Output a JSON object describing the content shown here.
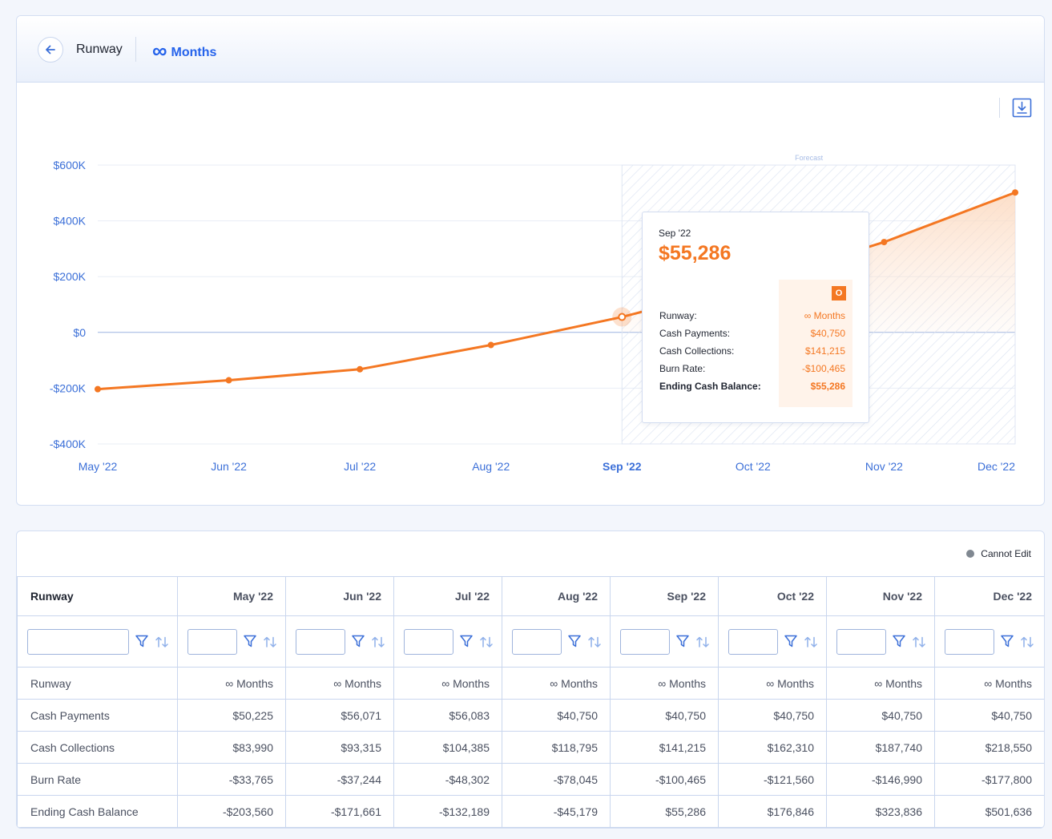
{
  "header": {
    "title": "Runway",
    "runway_symbol": "∞",
    "runway_label": "Months"
  },
  "chart": {
    "region_label": "Forecast",
    "colors": {
      "line": "#f47722",
      "axis_text": "#3b6fd8",
      "forecast_hatch": "#dbe3f2",
      "zero_line": "#9bb3e0"
    }
  },
  "chart_data": {
    "type": "line",
    "categories": [
      "May '22",
      "Jun '22",
      "Jul '22",
      "Aug '22",
      "Sep '22",
      "Oct '22",
      "Nov '22",
      "Dec '22"
    ],
    "series": [
      {
        "name": "Ending Cash Balance",
        "values": [
          -203560,
          -171661,
          -132189,
          -45179,
          55286,
          176846,
          323836,
          501636
        ]
      }
    ],
    "yticks": [
      "$600K",
      "$400K",
      "$200K",
      "$0",
      "-$200K",
      "-$400K"
    ],
    "ytick_values": [
      600000,
      400000,
      200000,
      0,
      -200000,
      -400000
    ],
    "ylim": [
      -400000,
      600000
    ],
    "highlighted": "Sep '22",
    "forecast_from": "Sep '22",
    "grid": true
  },
  "tooltip": {
    "date": "Sep '22",
    "value": "$55,286",
    "badge": "O",
    "rows": [
      {
        "label": "Runway:",
        "value": "∞ Months"
      },
      {
        "label": "Cash Payments:",
        "value": "$40,750"
      },
      {
        "label": "Cash Collections:",
        "value": "$141,215"
      },
      {
        "label": "Burn Rate:",
        "value": "-$100,465"
      },
      {
        "label": "Ending Cash Balance:",
        "value": "$55,286"
      }
    ]
  },
  "legend": {
    "label": "Cannot Edit"
  },
  "table": {
    "corner": "Runway",
    "columns": [
      "May '22",
      "Jun '22",
      "Jul '22",
      "Aug '22",
      "Sep '22",
      "Oct '22",
      "Nov '22",
      "Dec '22"
    ],
    "rows": [
      {
        "label": "Runway",
        "values": [
          "∞ Months",
          "∞ Months",
          "∞ Months",
          "∞ Months",
          "∞ Months",
          "∞ Months",
          "∞ Months",
          "∞ Months"
        ]
      },
      {
        "label": "Cash Payments",
        "values": [
          "$50,225",
          "$56,071",
          "$56,083",
          "$40,750",
          "$40,750",
          "$40,750",
          "$40,750",
          "$40,750"
        ]
      },
      {
        "label": "Cash Collections",
        "values": [
          "$83,990",
          "$93,315",
          "$104,385",
          "$118,795",
          "$141,215",
          "$162,310",
          "$187,740",
          "$218,550"
        ]
      },
      {
        "label": "Burn Rate",
        "values": [
          "-$33,765",
          "-$37,244",
          "-$48,302",
          "-$78,045",
          "-$100,465",
          "-$121,560",
          "-$146,990",
          "-$177,800"
        ]
      },
      {
        "label": "Ending Cash Balance",
        "values": [
          "-$203,560",
          "-$171,661",
          "-$132,189",
          "-$45,179",
          "$55,286",
          "$176,846",
          "$323,836",
          "$501,636"
        ]
      }
    ]
  }
}
